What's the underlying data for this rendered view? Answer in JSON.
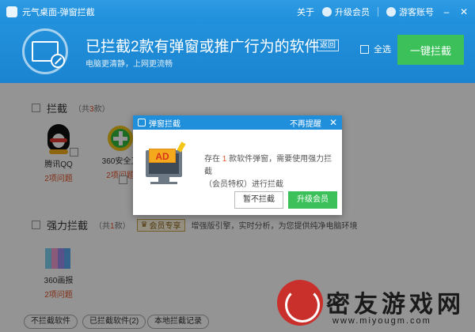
{
  "titlebar": {
    "app_name": "元气桌面-弹窗拦截",
    "about": "关于",
    "upgrade_vip": "升级会员",
    "account": "游客账号",
    "minimize": "–",
    "close": "✕"
  },
  "banner": {
    "headline": "已拦截2款有弹窗或推广行为的软件",
    "back": "返回",
    "subtitle": "电脑更清静，上网更流畅",
    "select_all": "全选",
    "block_all": "一键拦截"
  },
  "sections": {
    "block": {
      "title": "拦截",
      "count_prefix": "（共",
      "count": "3",
      "count_suffix": "款）",
      "apps": [
        {
          "name": "腾讯QQ",
          "note": "2项问题"
        },
        {
          "name": "360安全卫",
          "note": "2项问题"
        }
      ]
    },
    "strong": {
      "title": "强力拦截",
      "count_prefix": "（共",
      "count": "1",
      "count_suffix": "款）",
      "vip_badge": "会员专享",
      "desc": "增强版引擎，实时分析，为您提供纯净电脑环境",
      "apps": [
        {
          "name": "360画报",
          "note": "2项问题"
        }
      ]
    }
  },
  "bottom": {
    "not_blocked": "不拦截软件",
    "blocked": "已拦截软件(2)",
    "log": "本地拦截记录"
  },
  "dialog": {
    "title": "弹窗拦截",
    "no_remind": "不再提醒",
    "close": "✕",
    "ad_label": "AD",
    "msg_pre": "存在",
    "msg_count": "1",
    "msg_post": "款软件弹窗，需要使用强力拦截",
    "msg_line2": "（会员特权）进行拦截",
    "skip": "暂不拦截",
    "upgrade": "升级会员"
  },
  "watermark": {
    "title": "密友游戏网",
    "url": "www.miyougm.com"
  },
  "colors": {
    "brand_blue": "#1f8fdc",
    "action_green": "#3cc15a",
    "highlight_orange": "#e0542a"
  }
}
